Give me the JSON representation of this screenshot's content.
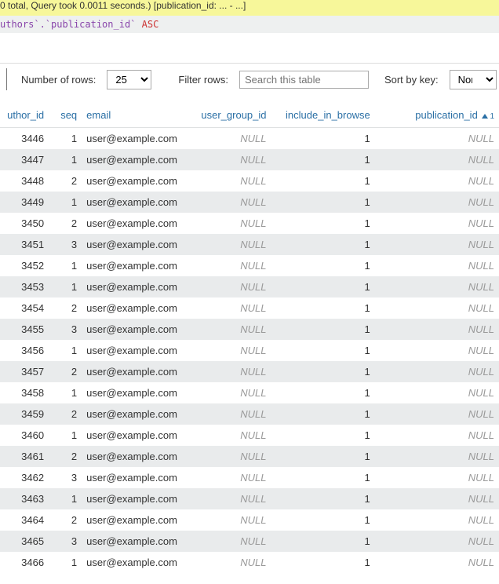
{
  "banner": {
    "text": "0 total, Query took 0.0011 seconds.) [publication_id: ... - ...]"
  },
  "sql": {
    "ident": "uthors`.`publication_id`",
    "key": "ASC"
  },
  "controls": {
    "rows_label": "Number of rows:",
    "rows_value": "25",
    "filter_label": "Filter rows:",
    "filter_placeholder": "Search this table",
    "sort_label": "Sort by key:",
    "sort_value": "None"
  },
  "columns": [
    {
      "label": "uthor_id",
      "align": "right"
    },
    {
      "label": "seq",
      "align": "right"
    },
    {
      "label": "email",
      "align": "left"
    },
    {
      "label": "user_group_id",
      "align": "right"
    },
    {
      "label": "include_in_browse",
      "align": "right"
    },
    {
      "label": "publication_id",
      "align": "right",
      "sorted": true,
      "sort_order": "1"
    }
  ],
  "null_text": "NULL",
  "rows": [
    {
      "author_id": 3446,
      "seq": 1,
      "email": "user@example.com",
      "user_group_id": null,
      "include_in_browse": 1,
      "publication_id": null
    },
    {
      "author_id": 3447,
      "seq": 1,
      "email": "user@example.com",
      "user_group_id": null,
      "include_in_browse": 1,
      "publication_id": null
    },
    {
      "author_id": 3448,
      "seq": 2,
      "email": "user@example.com",
      "user_group_id": null,
      "include_in_browse": 1,
      "publication_id": null
    },
    {
      "author_id": 3449,
      "seq": 1,
      "email": "user@example.com",
      "user_group_id": null,
      "include_in_browse": 1,
      "publication_id": null
    },
    {
      "author_id": 3450,
      "seq": 2,
      "email": "user@example.com",
      "user_group_id": null,
      "include_in_browse": 1,
      "publication_id": null
    },
    {
      "author_id": 3451,
      "seq": 3,
      "email": "user@example.com",
      "user_group_id": null,
      "include_in_browse": 1,
      "publication_id": null
    },
    {
      "author_id": 3452,
      "seq": 1,
      "email": "user@example.com",
      "user_group_id": null,
      "include_in_browse": 1,
      "publication_id": null
    },
    {
      "author_id": 3453,
      "seq": 1,
      "email": "user@example.com",
      "user_group_id": null,
      "include_in_browse": 1,
      "publication_id": null
    },
    {
      "author_id": 3454,
      "seq": 2,
      "email": "user@example.com",
      "user_group_id": null,
      "include_in_browse": 1,
      "publication_id": null
    },
    {
      "author_id": 3455,
      "seq": 3,
      "email": "user@example.com",
      "user_group_id": null,
      "include_in_browse": 1,
      "publication_id": null
    },
    {
      "author_id": 3456,
      "seq": 1,
      "email": "user@example.com",
      "user_group_id": null,
      "include_in_browse": 1,
      "publication_id": null
    },
    {
      "author_id": 3457,
      "seq": 2,
      "email": "user@example.com",
      "user_group_id": null,
      "include_in_browse": 1,
      "publication_id": null
    },
    {
      "author_id": 3458,
      "seq": 1,
      "email": "user@example.com",
      "user_group_id": null,
      "include_in_browse": 1,
      "publication_id": null
    },
    {
      "author_id": 3459,
      "seq": 2,
      "email": "user@example.com",
      "user_group_id": null,
      "include_in_browse": 1,
      "publication_id": null
    },
    {
      "author_id": 3460,
      "seq": 1,
      "email": "user@example.com",
      "user_group_id": null,
      "include_in_browse": 1,
      "publication_id": null
    },
    {
      "author_id": 3461,
      "seq": 2,
      "email": "user@example.com",
      "user_group_id": null,
      "include_in_browse": 1,
      "publication_id": null
    },
    {
      "author_id": 3462,
      "seq": 3,
      "email": "user@example.com",
      "user_group_id": null,
      "include_in_browse": 1,
      "publication_id": null
    },
    {
      "author_id": 3463,
      "seq": 1,
      "email": "user@example.com",
      "user_group_id": null,
      "include_in_browse": 1,
      "publication_id": null
    },
    {
      "author_id": 3464,
      "seq": 2,
      "email": "user@example.com",
      "user_group_id": null,
      "include_in_browse": 1,
      "publication_id": null
    },
    {
      "author_id": 3465,
      "seq": 3,
      "email": "user@example.com",
      "user_group_id": null,
      "include_in_browse": 1,
      "publication_id": null
    },
    {
      "author_id": 3466,
      "seq": 1,
      "email": "user@example.com",
      "user_group_id": null,
      "include_in_browse": 1,
      "publication_id": null
    }
  ]
}
